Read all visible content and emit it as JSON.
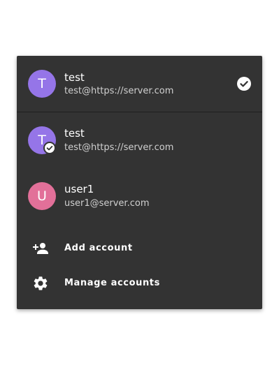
{
  "current_account": {
    "avatar_letter": "T",
    "avatar_color": "#9575e8",
    "name": "test",
    "email": "test@https://server.com",
    "selected_icon": "check-circle-icon"
  },
  "accounts": [
    {
      "avatar_letter": "T",
      "avatar_color": "#9575e8",
      "name": "test",
      "email": "test@https://server.com",
      "badge_icon": "check-badge-icon"
    },
    {
      "avatar_letter": "U",
      "avatar_color": "#e27099",
      "name": "user1",
      "email": "user1@server.com"
    }
  ],
  "actions": {
    "add_account": {
      "label": "Add account",
      "icon": "person-add-icon"
    },
    "manage_accounts": {
      "label": "Manage accounts",
      "icon": "gear-icon"
    }
  },
  "colors": {
    "panel_background": "#333333",
    "text_primary": "#ffffff",
    "text_secondary": "#d0d0d0"
  }
}
